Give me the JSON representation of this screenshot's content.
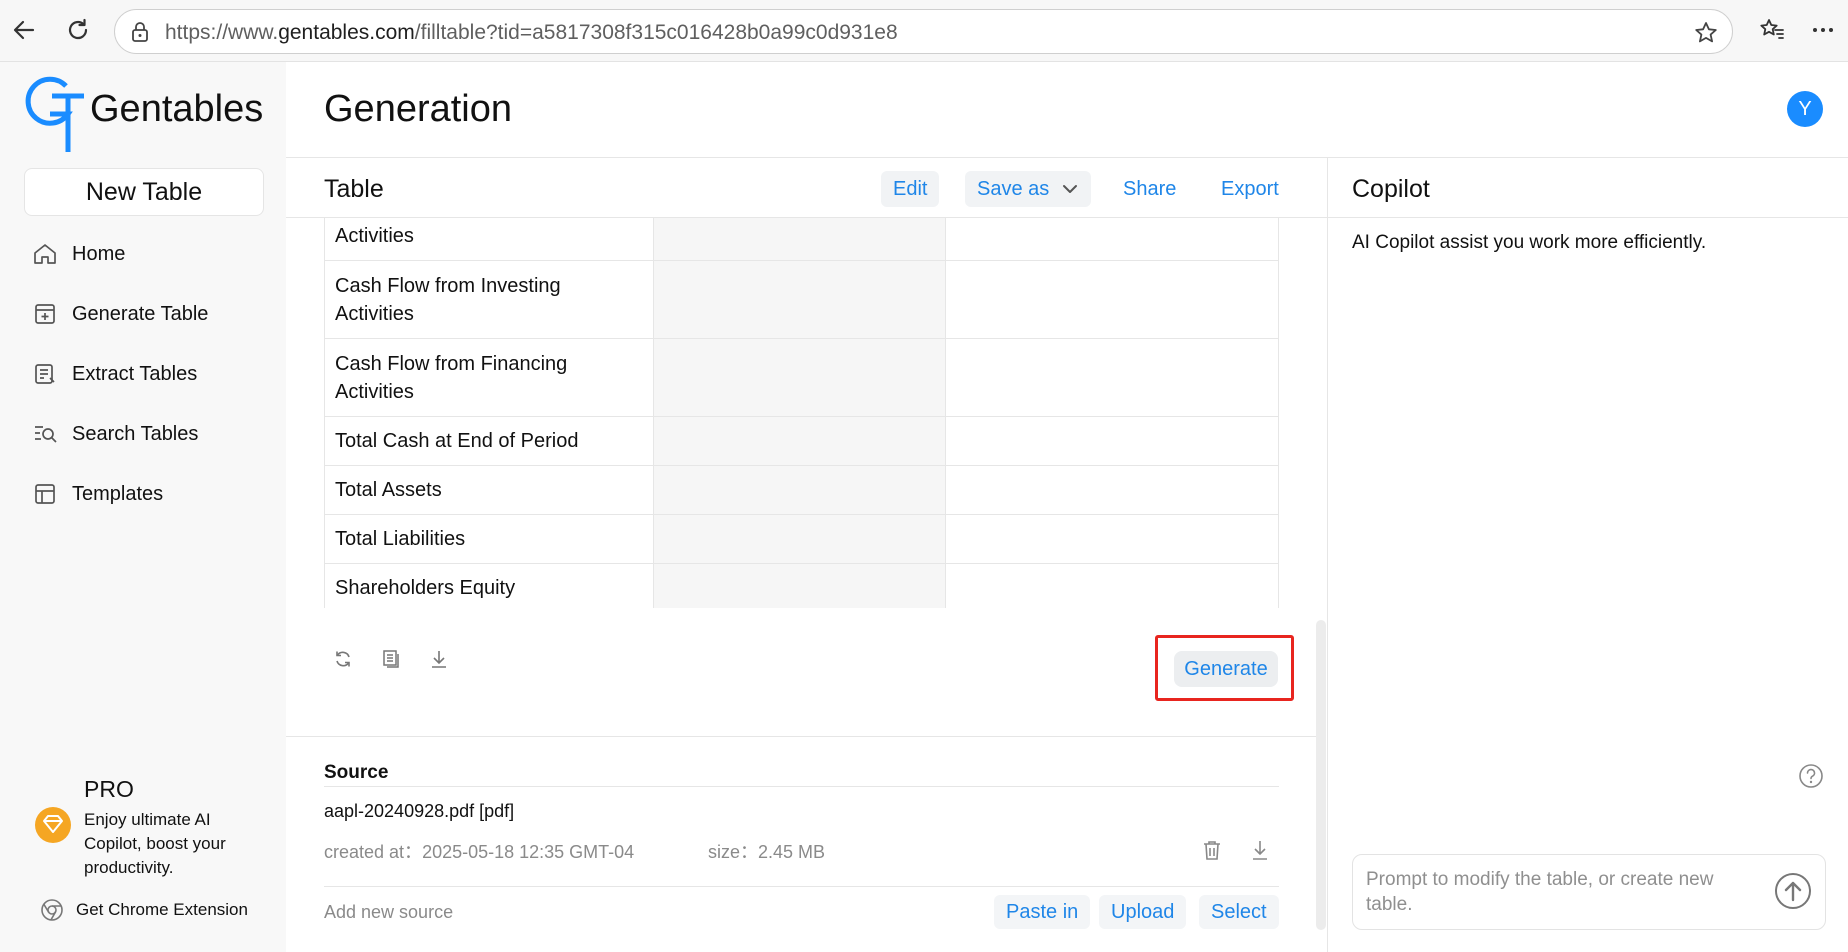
{
  "browser": {
    "url_prefix": "https://www.",
    "url_domain": "gentables.com",
    "url_path": "/filltable?tid=a5817308f315c016428b0a99c0d931e8"
  },
  "sidebar": {
    "logo_text": "Gentables",
    "new_table_label": "New Table",
    "items": [
      {
        "label": "Home",
        "icon": "home-icon"
      },
      {
        "label": "Generate Table",
        "icon": "generate-table-icon"
      },
      {
        "label": "Extract Tables",
        "icon": "extract-tables-icon"
      },
      {
        "label": "Search Tables",
        "icon": "search-tables-icon"
      },
      {
        "label": "Templates",
        "icon": "templates-icon"
      }
    ],
    "pro_title": "PRO",
    "pro_desc": "Enjoy ultimate AI Copilot, boost your productivity.",
    "chrome_ext_label": "Get Chrome Extension"
  },
  "header": {
    "title": "Generation",
    "avatar_letter": "Y"
  },
  "table_panel": {
    "title": "Table",
    "edit_label": "Edit",
    "save_as_label": "Save as",
    "share_label": "Share",
    "export_label": "Export",
    "rows": [
      [
        "Activities"
      ],
      [
        "Cash Flow from Investing Activities"
      ],
      [
        "Cash Flow from Financing Activities"
      ],
      [
        "Total Cash at End of Period"
      ],
      [
        "Total Assets"
      ],
      [
        "Total Liabilities"
      ],
      [
        "Shareholders Equity"
      ]
    ],
    "generate_label": "Generate"
  },
  "source": {
    "title": "Source",
    "file_name": "aapl-20240928.pdf [pdf]",
    "created_label": "created at：",
    "created_value": "2025-05-18 12:35 GMT-04",
    "size_label": "size：",
    "size_value": "2.45 MB",
    "add_new_label": "Add new source",
    "paste_label": "Paste in",
    "upload_label": "Upload",
    "select_label": "Select"
  },
  "copilot": {
    "title": "Copilot",
    "description": "AI Copilot assist you work more efficiently.",
    "prompt_placeholder": "Prompt to modify the table, or create new table."
  },
  "colors": {
    "accent": "#1f86e8",
    "avatar": "#1a8cff",
    "highlight": "#e8251f",
    "pro_badge": "#f5a623"
  }
}
